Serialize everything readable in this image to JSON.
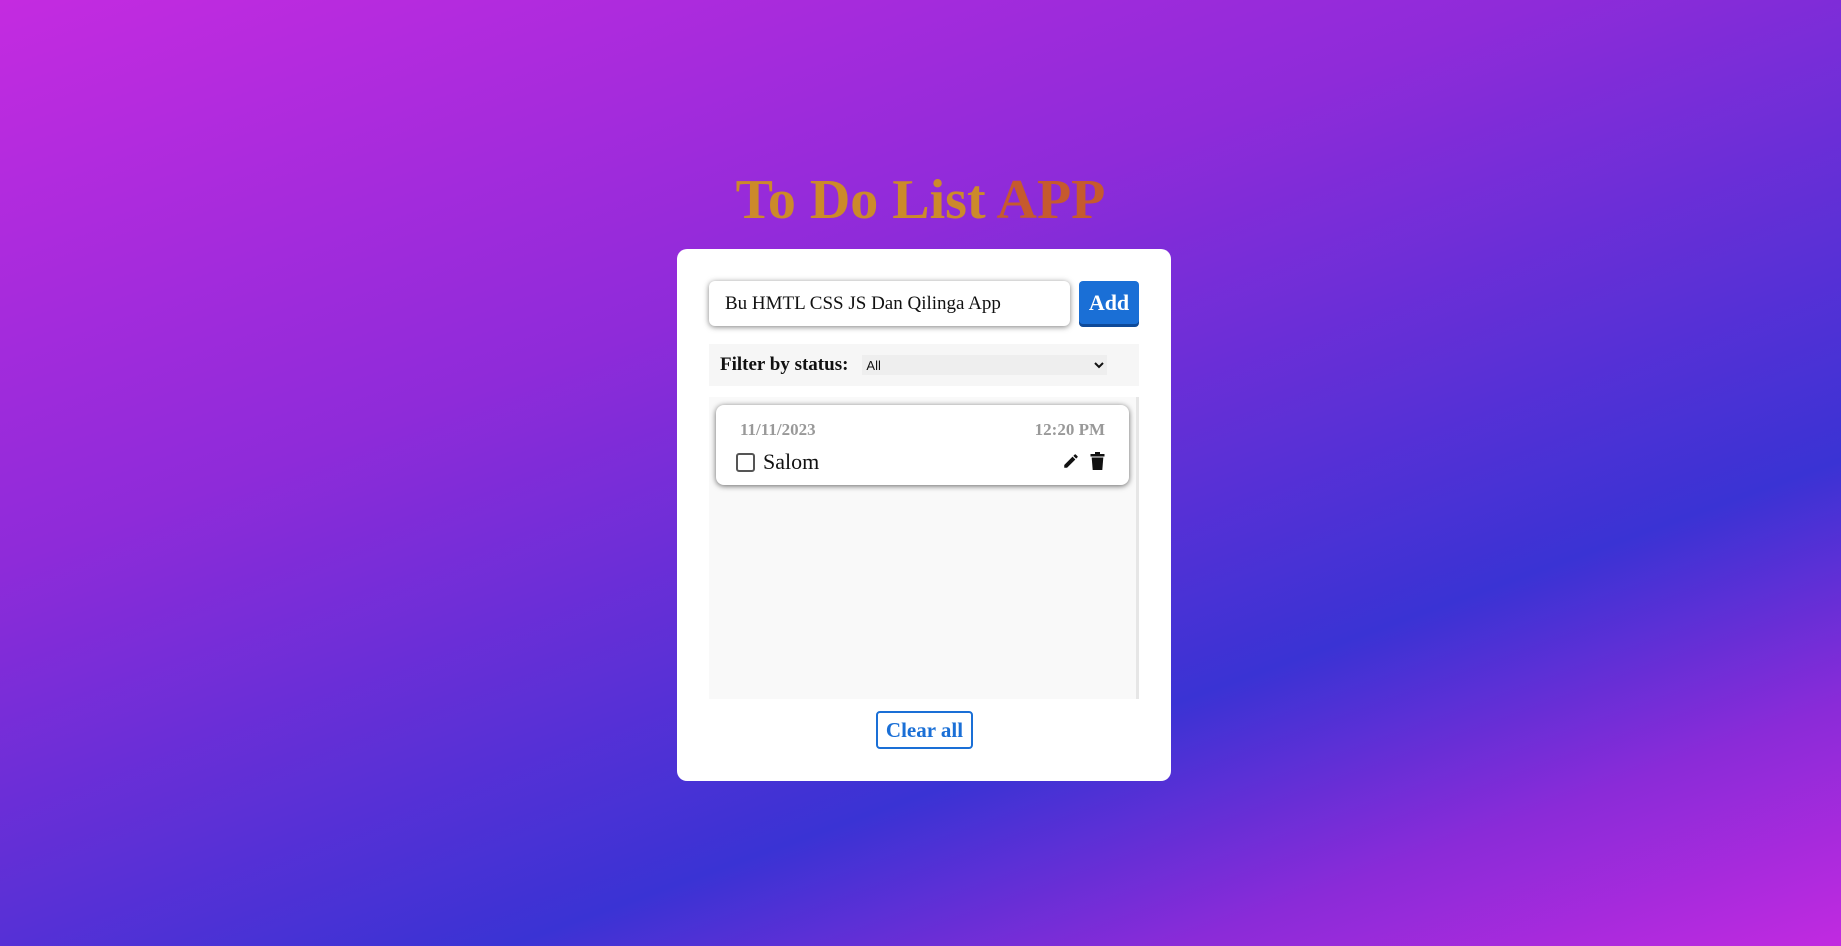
{
  "header": {
    "title_main": "To Do List ",
    "title_app": "APP"
  },
  "form": {
    "input_value": "Bu HMTL CSS JS Dan Qilinga App",
    "add_label": "Add"
  },
  "filter": {
    "label": "Filter by status:",
    "selected": "All"
  },
  "tasks": [
    {
      "date": "11/11/2023",
      "time": "12:20 PM",
      "text": "Salom",
      "done": false
    }
  ],
  "footer": {
    "clear_label": "Clear all"
  },
  "icons": {
    "edit": "pencil-icon",
    "delete": "trash-icon"
  },
  "colors": {
    "title": "#cc8a2a",
    "accent": "#1a6fd6"
  }
}
